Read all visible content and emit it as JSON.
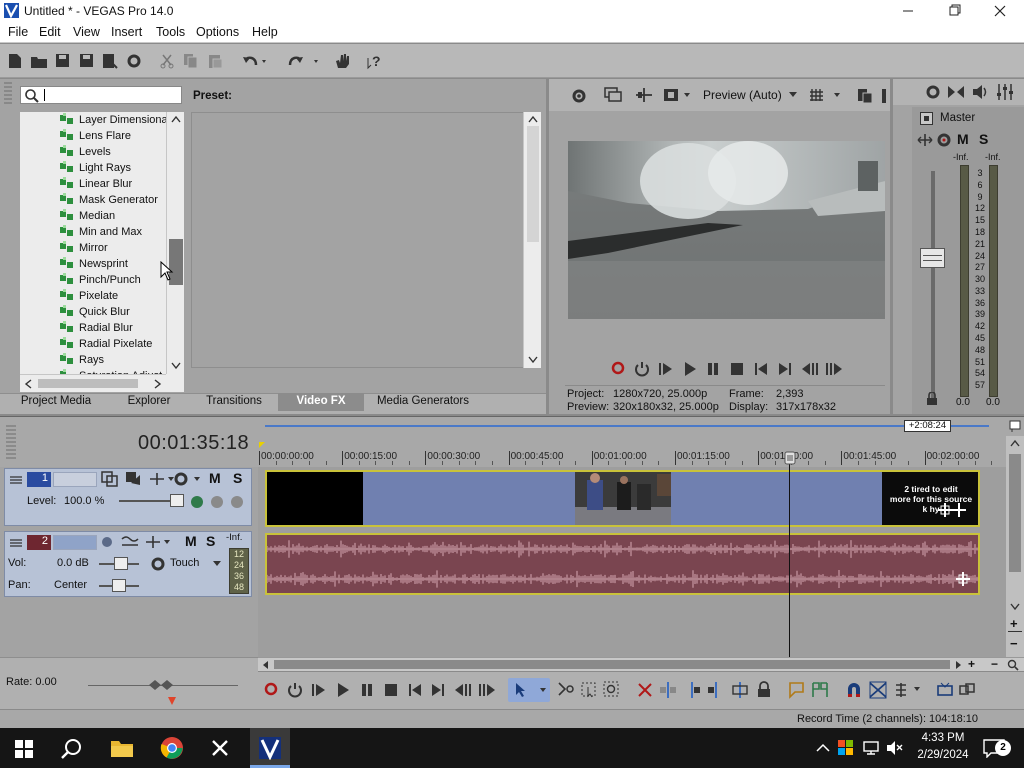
{
  "window": {
    "title": "Untitled * - VEGAS Pro 14.0",
    "controls": [
      "minimize",
      "maximize",
      "close"
    ]
  },
  "menu": [
    "File",
    "Edit",
    "View",
    "Insert",
    "Tools",
    "Options",
    "Help"
  ],
  "toolbar_icons": [
    "new-icon",
    "open-icon",
    "save-icon",
    "save-as-icon",
    "render-icon",
    "properties-icon",
    "cut-icon",
    "copy-icon",
    "paste-icon",
    "undo-icon",
    "redo-icon",
    "hand-icon",
    "whats-this-icon"
  ],
  "fx_panel": {
    "search_value": "",
    "preset_label": "Preset:",
    "items": [
      "Layer Dimensional",
      "Lens Flare",
      "Levels",
      "Light Rays",
      "Linear Blur",
      "Mask Generator",
      "Median",
      "Min and Max",
      "Mirror",
      "Newsprint",
      "Pinch/Punch",
      "Pixelate",
      "Quick Blur",
      "Radial Blur",
      "Radial Pixelate",
      "Rays",
      "Saturation Adjust"
    ],
    "tabs": [
      "Project Media",
      "Explorer",
      "Transitions",
      "Video FX",
      "Media Generators"
    ],
    "active_tab": "Video FX"
  },
  "preview": {
    "quality": "Preview (Auto)",
    "project_label": "Project:",
    "project_value": "1280x720, 25.000p",
    "frame_label": "Frame:",
    "frame_value": "2,393",
    "preview_label": "Preview:",
    "preview_value": "320x180x32, 25.000p",
    "display_label": "Display:",
    "display_value": "317x178x32"
  },
  "master": {
    "title": "Master",
    "m": "M",
    "s": "S",
    "inf_left": "-Inf.",
    "inf_right": "-Inf.",
    "scale": [
      "3",
      "6",
      "9",
      "12",
      "15",
      "18",
      "21",
      "24",
      "27",
      "30",
      "33",
      "36",
      "39",
      "42",
      "45",
      "48",
      "51",
      "54",
      "57"
    ],
    "level_left": "0.0",
    "level_right": "0.0",
    "fader_level_db": 0.0
  },
  "timeline": {
    "timecode": "00:01:35:18",
    "end_marker": "+2:08:24",
    "ruler": [
      "00:00:00:00",
      "00:00:15:00",
      "00:00:30:00",
      "00:00:45:00",
      "00:01:00:00",
      "00:01:15:00",
      "00:01:30:00",
      "00:01:45:00",
      "00:02:00:00"
    ],
    "video_track": {
      "number": "1",
      "level_label": "Level:",
      "level_value": "100.0 %",
      "m": "M",
      "s": "S"
    },
    "audio_track": {
      "number": "2",
      "vol_label": "Vol:",
      "vol_value": "0.0 dB",
      "pan_label": "Pan:",
      "pan_value": "Center",
      "automation": "Touch",
      "m": "M",
      "s": "S",
      "inf": "-Inf.",
      "meter_scale": [
        "12",
        "24",
        "36",
        "48"
      ]
    },
    "clip_text": [
      "2 tired to edit",
      "more for this source",
      "k hy"
    ],
    "rate_label": "Rate: 0.00",
    "status": "Record Time (2 channels): 104:18:10"
  },
  "taskbar": {
    "time": "4:33 PM",
    "date": "2/29/2024",
    "notifications": "2",
    "apps": [
      "start-icon",
      "search-icon",
      "file-explorer-icon",
      "chrome-icon",
      "x-icon",
      "vegas-icon"
    ]
  },
  "colors": {
    "accent": "#1a6fd1",
    "video_track": "#7080b0",
    "audio_track": "#7a4550",
    "clip_border": "#c9c23a",
    "track_header": "#b7c2d6"
  }
}
